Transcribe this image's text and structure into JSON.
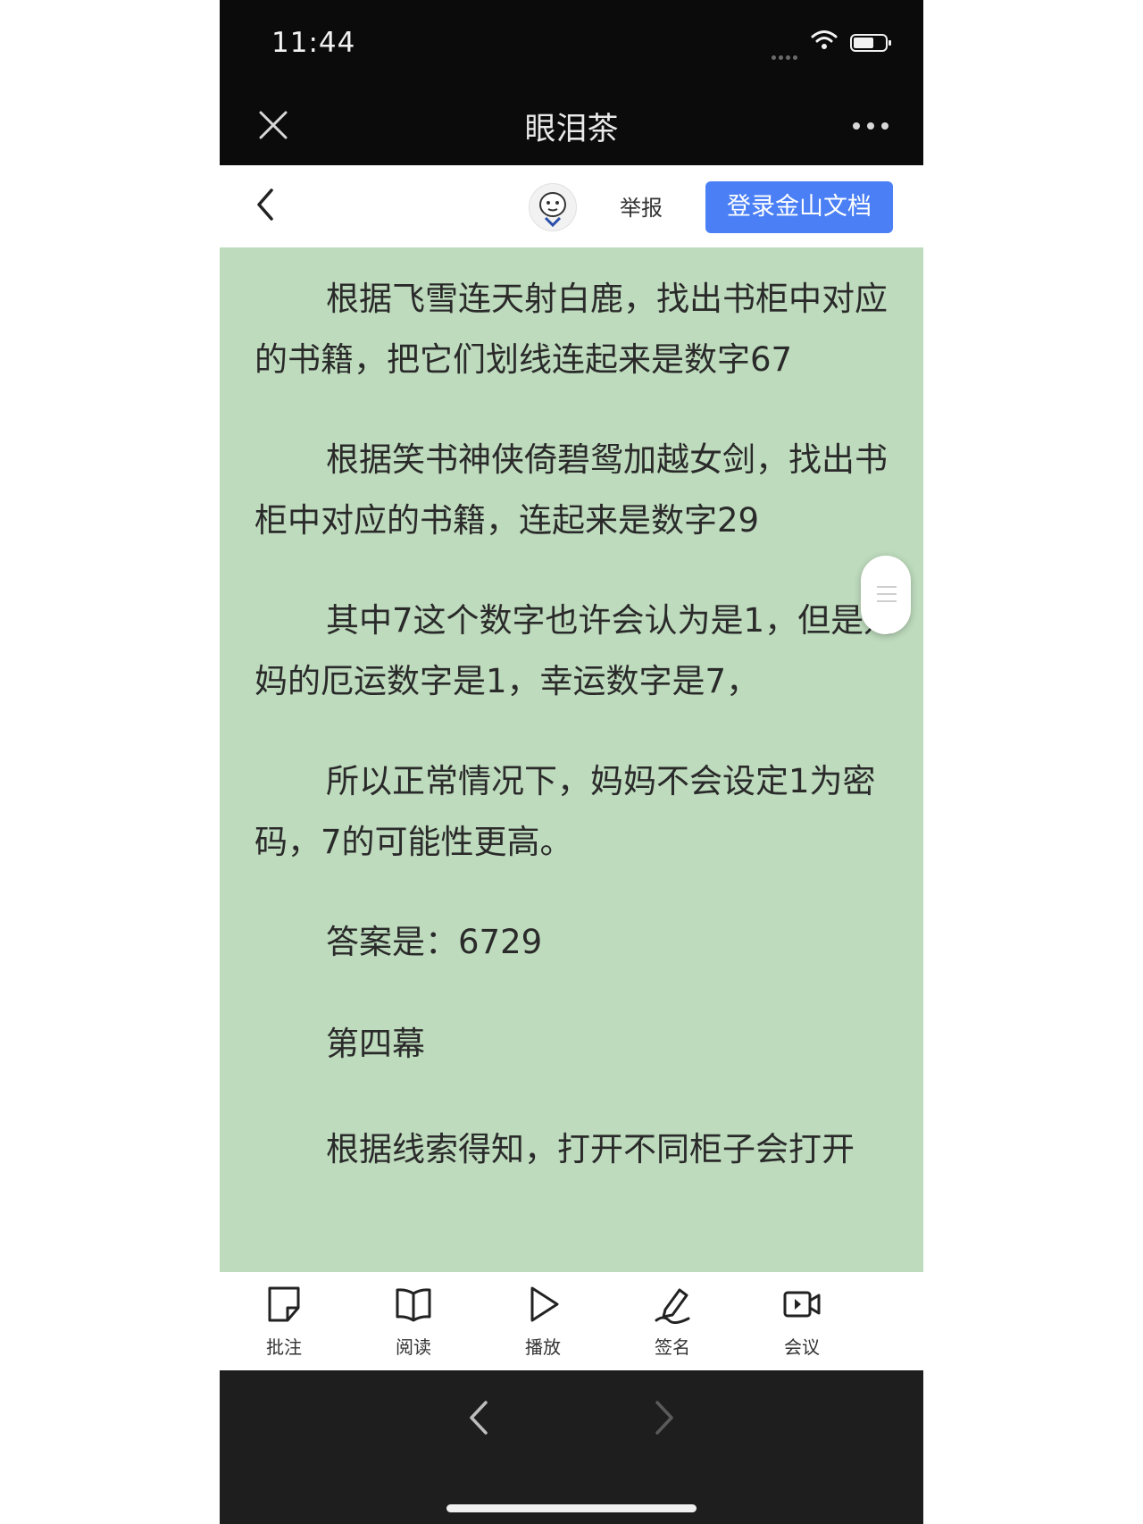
{
  "status_bar": {
    "time": "11:44"
  },
  "header": {
    "title": "眼泪茶"
  },
  "toolbar": {
    "report_label": "举报",
    "login_label": "登录金山文档"
  },
  "content": {
    "paragraphs": [
      "根据飞雪连天射白鹿，找出书柜中对应的书籍，把它们划线连起来是数字67",
      "根据笑书神侠倚碧鸳加越女剑，找出书柜中对应的书籍，连起来是数字29",
      "其中7这个数字也许会认为是1，但是妈妈的厄运数字是1，幸运数字是7，",
      "所以正常情况下，妈妈不会设定1为密码，7的可能性更高。",
      "答案是：6729",
      "第四幕",
      "根据线索得知，打开不同柜子会打开"
    ]
  },
  "bottom_bar": {
    "items": [
      {
        "label": "批注",
        "icon": "note-icon"
      },
      {
        "label": "阅读",
        "icon": "book-icon"
      },
      {
        "label": "播放",
        "icon": "play-icon"
      },
      {
        "label": "签名",
        "icon": "signature-icon"
      },
      {
        "label": "会议",
        "icon": "video-icon"
      }
    ]
  },
  "colors": {
    "content_background": "#bedbbd",
    "login_button": "#4a7ff5",
    "top_bar": "#0b0b0b",
    "nav_bar": "#1e1e1e"
  }
}
